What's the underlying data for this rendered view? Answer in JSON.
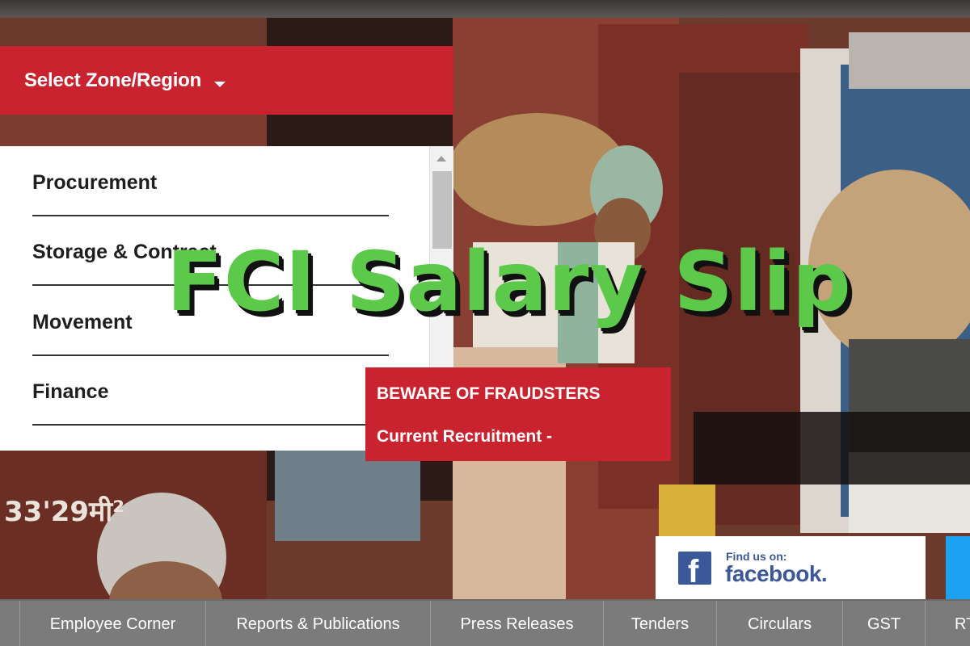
{
  "zone_select": {
    "label": "Select Zone/Region"
  },
  "menu": {
    "items": [
      {
        "label": "Procurement"
      },
      {
        "label": "Storage & Contract"
      },
      {
        "label": "Movement"
      },
      {
        "label": "Finance"
      }
    ]
  },
  "overlay": {
    "title": "FCI Salary Slip"
  },
  "news": {
    "items": [
      {
        "label": "BEWARE OF FRAUDSTERS"
      },
      {
        "label": "Current Recruitment -"
      }
    ]
  },
  "facebook": {
    "find_us": "Find us on:",
    "name": "facebook."
  },
  "photo_text": {
    "wagon_marking": "33'29मी²"
  },
  "bottom_nav": {
    "items": [
      {
        "label": "Employee Corner"
      },
      {
        "label": "Reports & Publications"
      },
      {
        "label": "Press Releases"
      },
      {
        "label": "Tenders"
      },
      {
        "label": "Circulars"
      },
      {
        "label": "GST"
      },
      {
        "label": "RTI"
      }
    ]
  },
  "colors": {
    "brand_red": "#c8232f",
    "overlay_green": "#5cc94a",
    "nav_gray": "#7b7b7b",
    "facebook_blue": "#3b5998"
  },
  "icons": [
    "chevron-down-icon",
    "scroll-up-icon",
    "facebook-icon"
  ]
}
